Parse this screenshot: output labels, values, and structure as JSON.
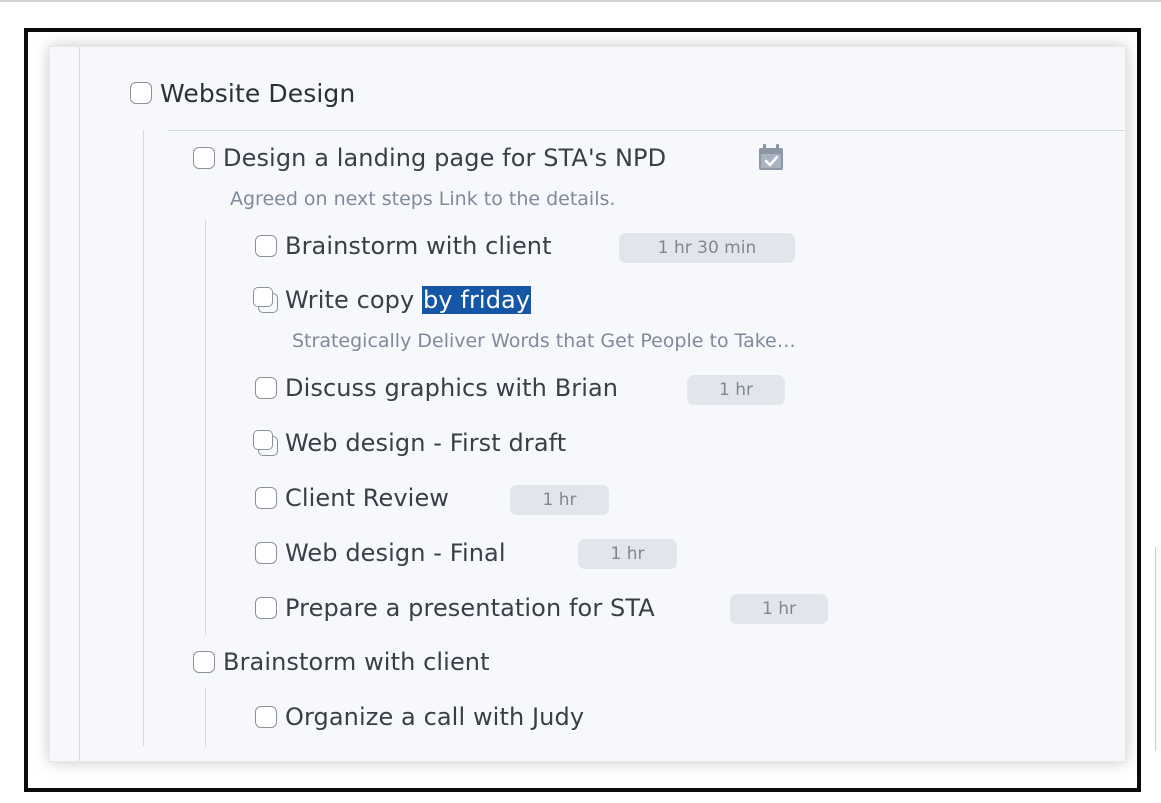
{
  "project": {
    "title": "Website Design"
  },
  "tasks": {
    "landing": {
      "title": "Design a landing page for STA's NPD",
      "note": "Agreed on next steps Link to the details.",
      "icon": "calendar-check-icon"
    },
    "brainstorm_client": {
      "title": "Brainstorm with client",
      "duration": "1 hr 30 min"
    },
    "write_copy": {
      "title_prefix": "Write copy ",
      "title_highlight": "by friday",
      "note": "Strategically Deliver Words that Get People to Take…"
    },
    "discuss_graphics": {
      "title": "Discuss graphics with Brian",
      "duration": "1 hr"
    },
    "web_first_draft": {
      "title": "Web design - First draft"
    },
    "client_review": {
      "title": "Client Review",
      "duration": "1 hr"
    },
    "web_final": {
      "title": "Web design - Final",
      "duration": "1 hr"
    },
    "presentation": {
      "title": "Prepare a presentation for STA",
      "duration": "1 hr"
    },
    "brainstorm_group": {
      "title": "Brainstorm with client"
    },
    "organize_call": {
      "title": "Organize a call with Judy"
    }
  },
  "colors": {
    "highlight": "#1557a6",
    "badge_bg": "#e2e6ec",
    "note_text": "#7f8a9a"
  }
}
